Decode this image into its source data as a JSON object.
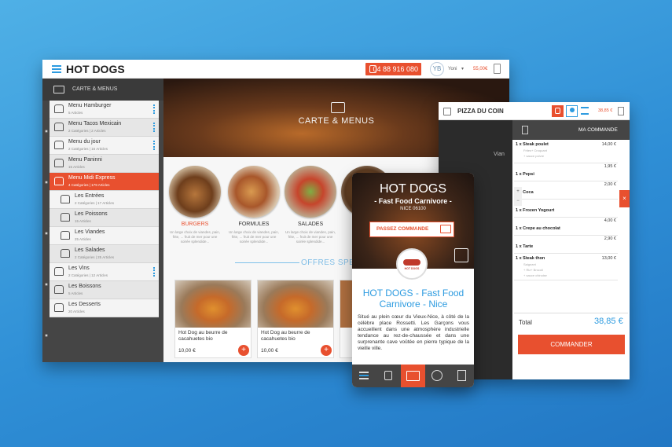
{
  "main": {
    "title": "HOT DOGS",
    "phone": "04 88 916 080",
    "avatar_initials": "YB",
    "user_name": "Yoni",
    "cart_total": "55,00€",
    "sidebar_header": "CARTE & MENUS",
    "menu": [
      {
        "label": "Menu Hamburger",
        "sub": "5 Articles",
        "style": "normal",
        "dots": true
      },
      {
        "label": "Menu Tacos Mexicain",
        "sub": "2 Catégories | 2 Articles",
        "style": "alt",
        "dots": true
      },
      {
        "label": "Menu du jour",
        "sub": "2 Catégories | 16 Articles",
        "style": "normal",
        "dots": true
      },
      {
        "label": "Menu Paninni",
        "sub": "15 Articles",
        "style": "alt",
        "dots": false
      },
      {
        "label": "Menu Midi Express",
        "sub": "4 Catégories | 179 Articles",
        "style": "active",
        "dots": false
      },
      {
        "label": "Les Entrées",
        "sub": "2 Catégories | 17 Articles",
        "style": "sub",
        "dots": false
      },
      {
        "label": "Les Poissons",
        "sub": "15 Articles",
        "style": "subalt",
        "dots": false
      },
      {
        "label": "Les Viandes",
        "sub": "25 Articles",
        "style": "sub",
        "dots": false
      },
      {
        "label": "Les Salades",
        "sub": "2 Catégories | 25 Articles",
        "style": "subalt",
        "dots": false
      },
      {
        "label": "Les Vins",
        "sub": "2 Catégories | 12 Articles",
        "style": "normal",
        "dots": true
      },
      {
        "label": "Les Boissons",
        "sub": "5 Articles",
        "style": "alt",
        "dots": false
      },
      {
        "label": "Les Desserts",
        "sub": "20 Articles",
        "style": "normal",
        "dots": false
      }
    ],
    "hero_title": "CARTE & MENUS",
    "categories": [
      {
        "label": "BURGERS",
        "desc": "Un large choix de viandes, pain, frite, ... fruit de mer pour une soirée splendide..."
      },
      {
        "label": "FORMULES",
        "desc": "Un large choix de viandes, pain, frite, ... fruit de mer pour une soirée splendide..."
      },
      {
        "label": "SALADES",
        "desc": "Un large choix de viandes, pain, frite, ... fruit de mer pour une soirée splendide..."
      }
    ],
    "offers_title": "OFFRES SPEC",
    "products": [
      {
        "name": "Hot Dog au beurre de cacahuetes bio",
        "price": "10,00 €"
      },
      {
        "name": "Hot Dog au beurre de cacahuetes bio",
        "price": "10,00 €"
      }
    ]
  },
  "right": {
    "title": "PIZZA DU COIN",
    "cart_total": "38,85 €",
    "order_header": "MA COMMANDE",
    "lines": [
      {
        "item": "1 x Steak poulet",
        "price": "14,00 €",
        "extras": [
          "Frites+ Croquant",
          "+ sauce poivre"
        ]
      },
      {
        "item": "1 x Pepsi",
        "price": "1,95 €",
        "extras": []
      },
      {
        "item": "1 x Coca",
        "price": "2,00 €",
        "extras": []
      },
      {
        "item": "1 x Frozen Yogourt",
        "price": "",
        "extras": []
      },
      {
        "item": "1 x Crepe au chocolat",
        "price": "4,00 €",
        "extras": []
      },
      {
        "item": "1 x Tarte",
        "price": "2,90 €",
        "extras": []
      },
      {
        "item": "1 x Steak thon",
        "price": "13,00 €",
        "extras": [
          "Saignant",
          "+ Riz+ Brocoli",
          "+ sauce chinoise"
        ]
      }
    ],
    "total_label": "Total",
    "total_value": "38,85 €",
    "order_button": "COMMANDER",
    "partial_text": "Vian"
  },
  "phone": {
    "title": "HOT DOGS",
    "subtitle": "- Fast Food Carnivore -",
    "location": "NICE 06100",
    "order_button": "PASSEZ COMMANDE",
    "logo_text": "HOT DOGS",
    "heading": "HOT DOGS - Fast Food Carnivore - Nice",
    "description": "Situé au plein cœur du Vieux-Nice, à côté de la célèbre place Rossetti. Les Garçons vous accueillent dans une atmosphère industrielle tendance au rez-de-chaussée et dans une surprenante cave voûtée en pierre typique de la vieille ville."
  },
  "colors": {
    "accent": "#e8502f",
    "blue": "#2d9be0",
    "dark": "#454545"
  }
}
